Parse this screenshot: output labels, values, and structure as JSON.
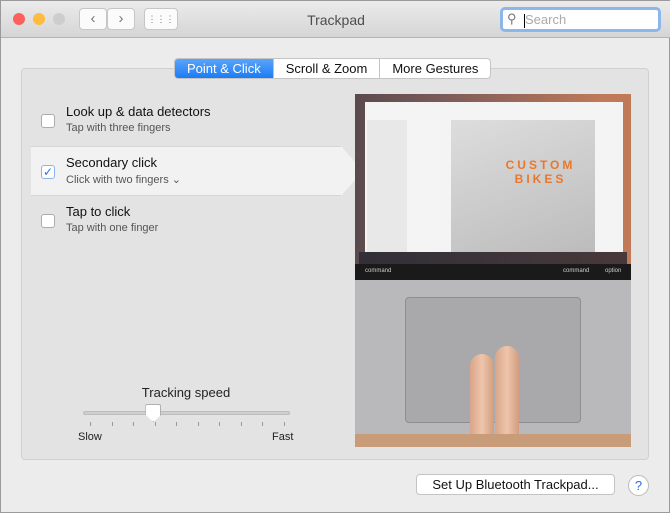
{
  "window": {
    "title": "Trackpad",
    "colors": {
      "close": "#fc605c",
      "minimize": "#fdbc40",
      "zoom": "#cdcdcd",
      "accent": "#1c7cf3"
    }
  },
  "toolbar": {
    "back_icon": "chevron-left-icon",
    "forward_icon": "chevron-right-icon",
    "grid_icon": "grid-icon",
    "back": "‹",
    "forward": "›",
    "grid": "⋮⋮⋮"
  },
  "search": {
    "placeholder": "Search",
    "value": ""
  },
  "tabs": [
    {
      "label": "Point & Click",
      "active": true
    },
    {
      "label": "Scroll & Zoom",
      "active": false
    },
    {
      "label": "More Gestures",
      "active": false
    }
  ],
  "options": [
    {
      "label": "Look up & data detectors",
      "sub": "Tap with three fingers",
      "checked": false
    },
    {
      "label": "Secondary click",
      "sub": "Click with two fingers ⌄",
      "checked": true,
      "selected": true
    },
    {
      "label": "Tap to click",
      "sub": "Tap with one finger",
      "checked": false
    }
  ],
  "preview": {
    "doc_title": "CUSTOM BIKES",
    "keys": [
      "command",
      "command",
      "option"
    ]
  },
  "tracking": {
    "label": "Tracking speed",
    "min_label": "Slow",
    "max_label": "Fast",
    "value_fraction": 0.34
  },
  "footer": {
    "setup_button": "Set Up Bluetooth Trackpad...",
    "help": "?"
  }
}
